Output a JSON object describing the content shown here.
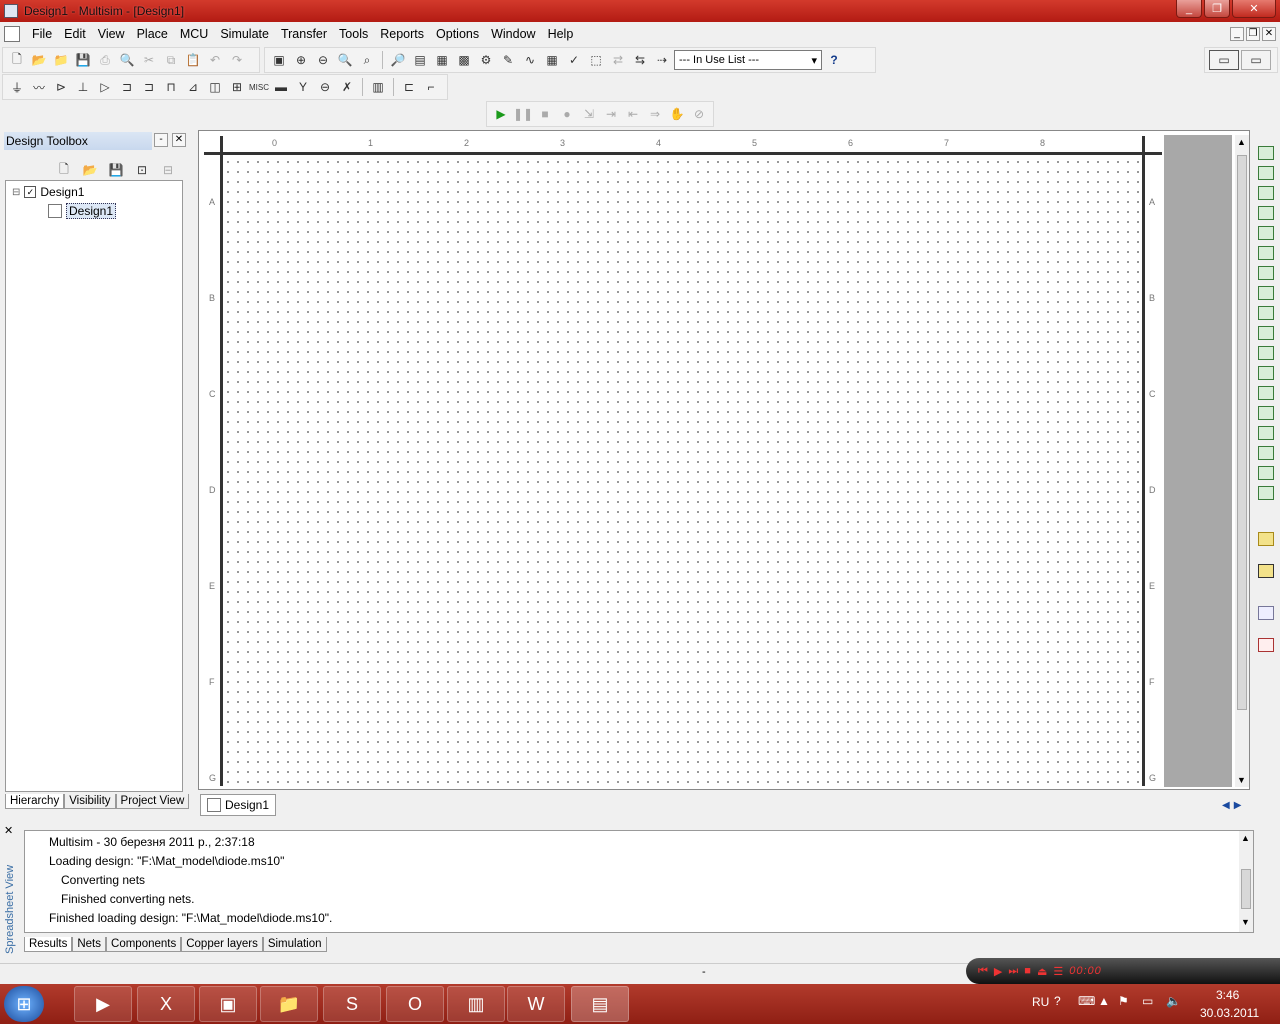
{
  "window": {
    "title": "Design1 - Multisim - [Design1]",
    "controls": {
      "minimize": "_",
      "restore": "❐",
      "close": "✕"
    }
  },
  "menubar": {
    "items": [
      "File",
      "Edit",
      "View",
      "Place",
      "MCU",
      "Simulate",
      "Transfer",
      "Tools",
      "Reports",
      "Options",
      "Window",
      "Help"
    ],
    "mdi_controls": [
      "_",
      "❐",
      "✕"
    ]
  },
  "toolbar": {
    "in_use_list": "--- In Use List ---",
    "help_icon": "?"
  },
  "toolbox": {
    "title": "Design Toolbox",
    "pin": "-",
    "close": "✕",
    "tree": [
      {
        "label": "Design1",
        "toggle": "⊟"
      },
      {
        "label": "Design1"
      }
    ],
    "tabs": [
      "Hierarchy",
      "Visibility",
      "Project View"
    ]
  },
  "ruler": {
    "columns": [
      "0",
      "1",
      "2",
      "3",
      "4",
      "5",
      "6",
      "7",
      "8"
    ],
    "rows": [
      "A",
      "B",
      "C",
      "D",
      "E",
      "F",
      "G"
    ]
  },
  "design_tab": {
    "label": "Design1"
  },
  "spreadsheet": {
    "side_label": "Spreadsheet View",
    "close": "✕",
    "log": [
      "Multisim  -  30 березня 2011 р., 2:37:18",
      "Loading design: \"F:\\Mat_model\\diode.ms10\"",
      "Converting nets",
      "Finished converting nets.",
      "Finished loading design: \"F:\\Mat_model\\diode.ms10\"."
    ],
    "tabs": [
      "Results",
      "Nets",
      "Components",
      "Copper layers",
      "Simulation"
    ]
  },
  "statusbar": {
    "center": "-"
  },
  "media": {
    "time": "00:00"
  },
  "taskbar": {
    "start": "⊞",
    "lang": "RU",
    "time": "3:46",
    "date": "30.03.2011"
  }
}
